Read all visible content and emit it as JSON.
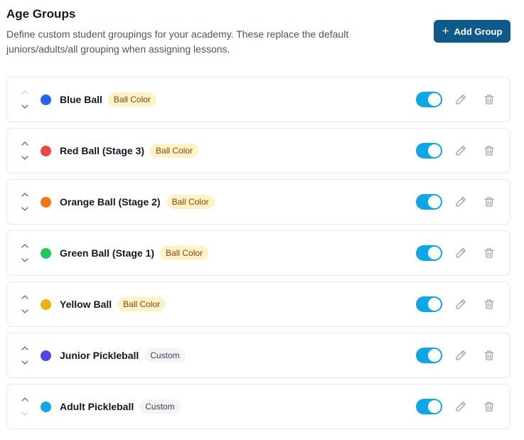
{
  "header": {
    "title": "Age Groups",
    "description": "Define custom student groupings for your academy. These replace the default juniors/adults/all grouping when assigning lessons.",
    "add_button_label": "Add Group"
  },
  "colors": {
    "accent": "#0f5a8a",
    "toggle_on": "#0ea5e9"
  },
  "icons": [
    "plus-icon",
    "chevron-up-icon",
    "chevron-down-icon",
    "pencil-icon",
    "trash-icon"
  ],
  "groups": [
    {
      "name": "Blue Ball",
      "badge": "Ball Color",
      "color": "#2563eb",
      "enabled": true
    },
    {
      "name": "Red Ball (Stage 3)",
      "badge": "Ball Color",
      "color": "#ef4444",
      "enabled": true
    },
    {
      "name": "Orange Ball (Stage 2)",
      "badge": "Ball Color",
      "color": "#f97316",
      "enabled": true
    },
    {
      "name": "Green Ball (Stage 1)",
      "badge": "Ball Color",
      "color": "#22c55e",
      "enabled": true
    },
    {
      "name": "Yellow Ball",
      "badge": "Ball Color",
      "color": "#eab308",
      "enabled": true
    },
    {
      "name": "Junior Pickleball",
      "badge": "Custom",
      "color": "#4f46e5",
      "enabled": true
    },
    {
      "name": "Adult Pickleball",
      "badge": "Custom",
      "color": "#0ea5e9",
      "enabled": true
    }
  ]
}
